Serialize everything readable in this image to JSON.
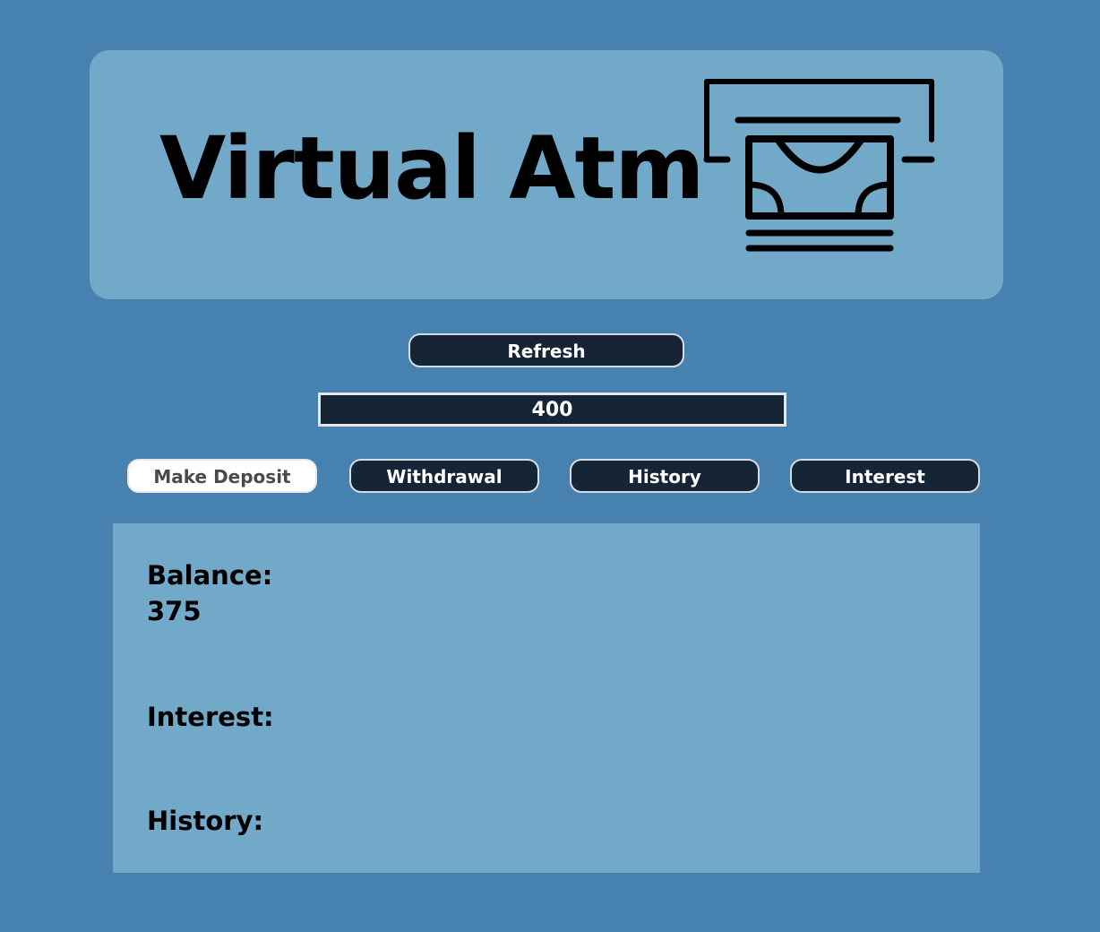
{
  "header": {
    "title": "Virtual Atm",
    "logo_icon": "atm-cash-icon"
  },
  "controls": {
    "refresh_label": "Refresh",
    "amount_value": "400"
  },
  "actions": {
    "deposit_label": "Make Deposit",
    "withdrawal_label": "Withdrawal",
    "history_label": "History",
    "interest_label": "Interest",
    "active": "Make Deposit"
  },
  "panel": {
    "balance_label": "Balance:",
    "balance_value": "375",
    "interest_label": "Interest:",
    "interest_value": "",
    "history_label": "History:"
  },
  "colors": {
    "page_background": "#4781b0",
    "panel_background": "#72a8c8",
    "button_background": "#162535",
    "button_text": "#ffffff",
    "active_button_background": "#ffffff",
    "active_button_text": "#4a4a4a"
  }
}
